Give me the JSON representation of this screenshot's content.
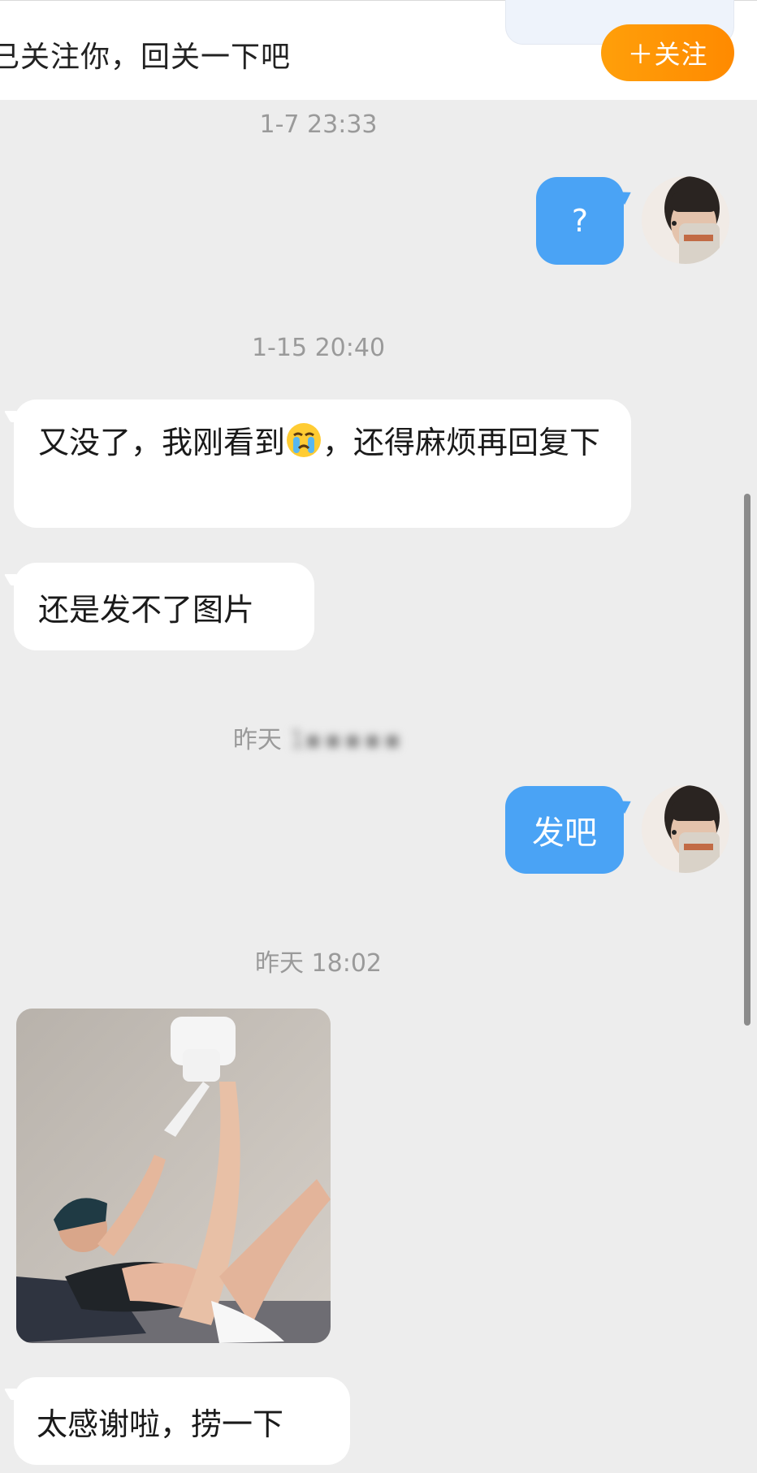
{
  "header": {
    "follow_prompt": "已关注你，回关一下吧",
    "follow_button": "＋关注",
    "accent_color": "#ff9500"
  },
  "messages": [
    {
      "type": "timestamp",
      "text": "1-7 23:33"
    },
    {
      "type": "outgoing",
      "text": "?"
    },
    {
      "type": "timestamp",
      "text": "1-15 20:40"
    },
    {
      "type": "incoming",
      "text_before_emoji": "又没了，我刚看到",
      "emoji": "crying-face-emoji",
      "text_after_emoji": "，还得麻烦再回复下"
    },
    {
      "type": "incoming",
      "text": "还是发不了图片"
    },
    {
      "type": "timestamp",
      "text": "昨天",
      "text_blurred": "1"
    },
    {
      "type": "outgoing",
      "text": "发吧"
    },
    {
      "type": "timestamp",
      "text": "昨天 18:02"
    },
    {
      "type": "incoming-image",
      "image": "photo-message"
    },
    {
      "type": "incoming",
      "text": "太感谢啦，捞一下"
    }
  ],
  "colors": {
    "background": "#ededed",
    "outgoing_bubble": "#4aa3f5",
    "incoming_bubble": "#ffffff",
    "timestamp": "#9a9a9a"
  }
}
